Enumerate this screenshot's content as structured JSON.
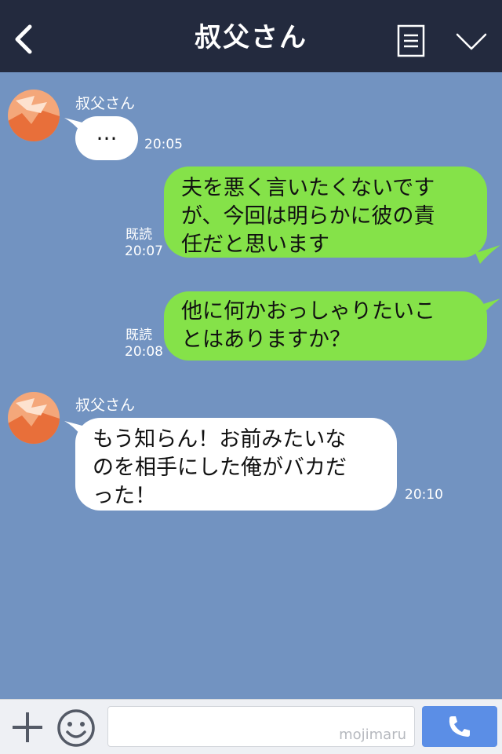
{
  "header": {
    "title": "叔父さん"
  },
  "messages": [
    {
      "side": "in",
      "sender": "叔父さん",
      "text": "…",
      "time": "20:05"
    },
    {
      "side": "out",
      "read": "既読",
      "time": "20:07",
      "lines": [
        "夫を悪く言いたくないです",
        "が、今回は明らかに彼の責",
        "任だと思います"
      ]
    },
    {
      "side": "out",
      "read": "既読",
      "time": "20:08",
      "lines": [
        "他に何かおっしゃりたいこ",
        "とはありますか？"
      ]
    },
    {
      "side": "in",
      "sender": "叔父さん",
      "time": "20:10",
      "lines": [
        "もう知らん！お前みたいな",
        "のを相手にした俺がバカだ",
        "った！"
      ]
    }
  ],
  "input": {
    "watermark": "mojimaru"
  },
  "colors": {
    "header_bg": "#232a3e",
    "chat_bg": "#7293c1",
    "outgoing_bubble": "#85e249",
    "incoming_bubble": "#ffffff",
    "call_button": "#5b8ee6"
  },
  "icons": {
    "back": "chevron-left-icon",
    "menu": "document-icon",
    "collapse": "chevron-down-icon",
    "add": "plus-icon",
    "emoji": "smile-icon",
    "call": "phone-icon"
  }
}
